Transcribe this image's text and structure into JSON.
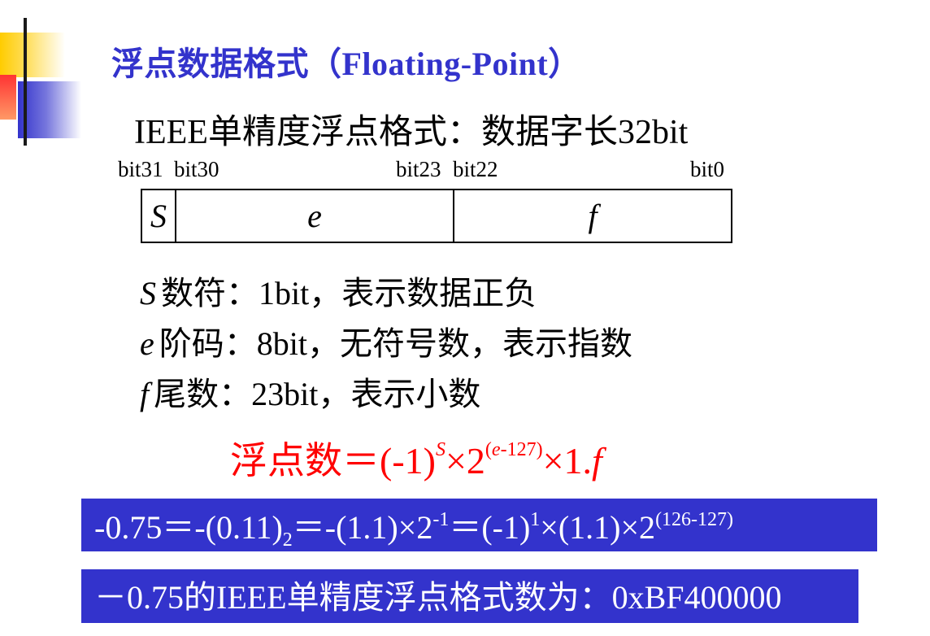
{
  "title": "浮点数据格式（Floating-Point）",
  "subtitle": "IEEE单精度浮点格式：数据字长32bit",
  "bit_labels": {
    "bit31": "bit31",
    "bit30": "bit30",
    "bit23": "bit23",
    "bit22": "bit22",
    "bit0": "bit0"
  },
  "fields": {
    "s": "S",
    "e": "e",
    "f": "f"
  },
  "descriptions": [
    {
      "symbol": "S",
      "text": "数符：1bit，表示数据正负"
    },
    {
      "symbol": "e",
      "text": "阶码：8bit，无符号数，表示指数"
    },
    {
      "symbol": "f",
      "text": "尾数：23bit，表示小数"
    }
  ],
  "formula": {
    "lhs": "浮点数＝(-1)",
    "exp_s": "S",
    "times_two": "×2",
    "exp_open": "(",
    "exp_e": "e",
    "exp_rest": "-127)",
    "times_one": "×1.",
    "f": "f"
  },
  "example": {
    "part1": "-0.75＝-(0.11)",
    "sub2": "2",
    "part2": "＝-(1.1)×2",
    "sup_neg1": "-1",
    "part3": "＝(-1)",
    "sup_1": "1",
    "part4": "×(1.1)×2",
    "sup_exp": "(126-127)"
  },
  "result": "－0.75的IEEE单精度浮点格式数为：0xBF400000",
  "colors": {
    "title": "#3333cc",
    "formula": "#ff0000",
    "box_bg": "#3333cc",
    "box_text": "#ffffff"
  }
}
